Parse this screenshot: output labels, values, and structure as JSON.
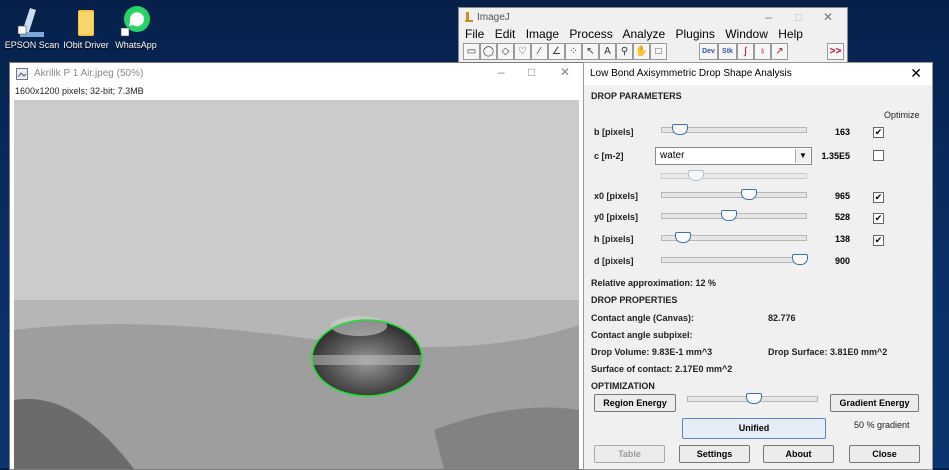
{
  "desktop": {
    "icons": [
      {
        "label": "EPSON Scan",
        "icon": "scanner-icon"
      },
      {
        "label": "IObit Driver",
        "icon": "folder-icon"
      },
      {
        "label": "WhatsApp",
        "icon": "whatsapp-icon"
      }
    ]
  },
  "imagej": {
    "title": "ImageJ",
    "menu": [
      "File",
      "Edit",
      "Image",
      "Process",
      "Analyze",
      "Plugins",
      "Window",
      "Help"
    ],
    "tools": [
      "rectangle",
      "oval",
      "polygon",
      "freehand",
      "line",
      "angle",
      "point",
      "wand",
      "text",
      "magnifier",
      "hand",
      "color-picker"
    ],
    "dev_label": "Dev",
    "stk_label": "Stk",
    "more_label": ">>"
  },
  "image_window": {
    "title": "Akrilik P 1 Air.jpeg (50%)",
    "info": "1600x1200 pixels; 32-bit; 7.3MB"
  },
  "dialog": {
    "title": "Low Bond Axisymmetric Drop Shape Analysis",
    "drop_parameters_heading": "DROP PARAMETERS",
    "optimize_heading": "Optimize",
    "params": {
      "b": {
        "label": "b [pixels]",
        "value": "163",
        "checked": true,
        "slider": 0.08
      },
      "c": {
        "label": "c [m-2]",
        "value": "1.35E5",
        "checked": false,
        "slider": 0.2,
        "dropdown": "water"
      },
      "x0": {
        "label": "x0 [pixels]",
        "value": "965",
        "checked": true,
        "slider": 0.61
      },
      "y0": {
        "label": "y0 [pixels]",
        "value": "528",
        "checked": true,
        "slider": 0.45
      },
      "h": {
        "label": "h [pixels]",
        "value": "138",
        "checked": true,
        "slider": 0.1
      },
      "d": {
        "label": "d [pixels]",
        "value": "900",
        "slider": 1.0
      }
    },
    "relative_approximation": "Relative approximation: 12 %",
    "drop_properties_heading": "DROP PROPERTIES",
    "contact_angle_canvas_label": "Contact angle (Canvas):",
    "contact_angle_canvas_value": "82.776",
    "contact_angle_subpixel_label": "Contact angle subpixel:",
    "drop_volume": "Drop Volume: 9.83E-1 mm^3",
    "drop_surface": "Drop Surface: 3.81E0 mm^2",
    "surface_of_contact": "Surface of contact: 2.17E0 mm^2",
    "optimization_heading": "OPTIMIZATION",
    "region_energy_label": "Region Energy",
    "gradient_energy_label": "Gradient Energy",
    "unified_label": "Unified",
    "gradient_percent": "50 % gradient",
    "gradient_slider": 0.5,
    "buttons": {
      "table": "Table",
      "settings": "Settings",
      "about": "About",
      "close": "Close"
    }
  }
}
